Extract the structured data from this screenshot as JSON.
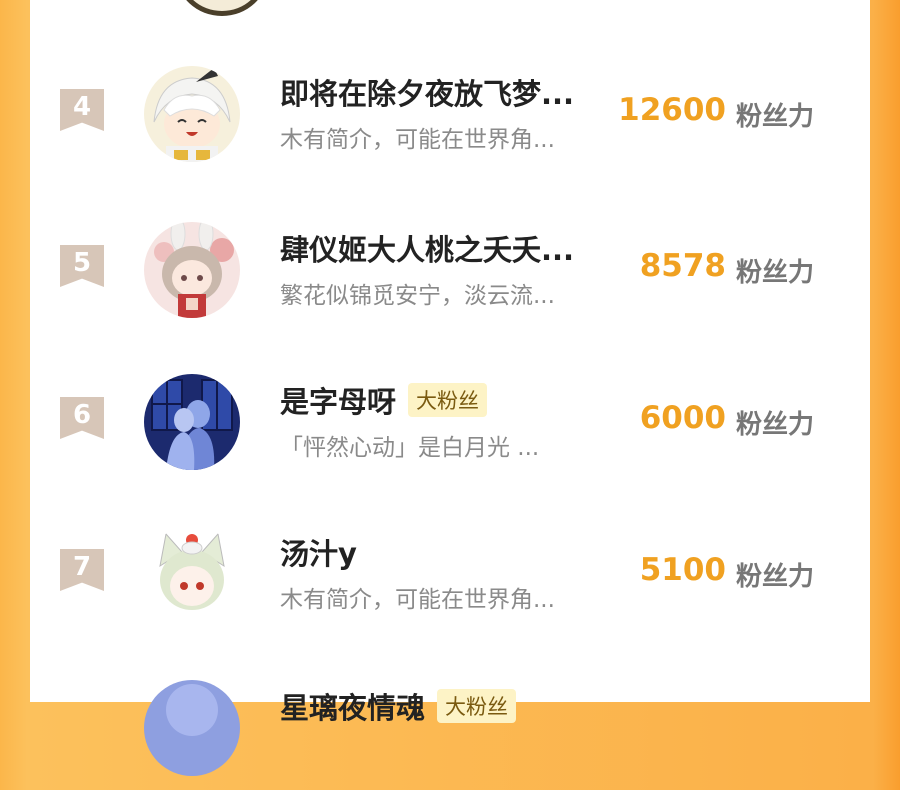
{
  "ranking": {
    "rows": [
      {
        "rank": "4",
        "name": "即将在除夕夜放飞梦...",
        "badge": "",
        "desc": "木有简介，可能在世界角...",
        "score": "12600",
        "unit": "粉丝力",
        "avatar_icon": "chibi-girl-white-hair"
      },
      {
        "rank": "5",
        "name": "肆仪姬大人桃之夭夭...",
        "badge": "",
        "desc": "繁花似锦觅安宁，淡云流...",
        "score": "8578",
        "unit": "粉丝力",
        "avatar_icon": "anime-girl-bunny-ears"
      },
      {
        "rank": "6",
        "name": "是字母呀",
        "badge": "大粉丝",
        "desc": "「怦然心动」是白月光 ...",
        "score": "6000",
        "unit": "粉丝力",
        "avatar_icon": "anime-couple-night-window"
      },
      {
        "rank": "7",
        "name": "汤汁y",
        "badge": "",
        "desc": "木有简介，可能在世界角...",
        "score": "5100",
        "unit": "粉丝力",
        "avatar_icon": "anime-catgirl-green-hair"
      },
      {
        "rank": "",
        "name": "星璃夜情魂",
        "badge": "大粉丝",
        "desc": "",
        "score": "",
        "unit": "",
        "avatar_icon": "blue-sky-avatar"
      }
    ]
  },
  "colors": {
    "background_orange": "#fbb64a",
    "score_orange": "#f0a121",
    "rank_badge": "#d7c6b8",
    "fan_badge_bg": "#fdf3c6"
  }
}
